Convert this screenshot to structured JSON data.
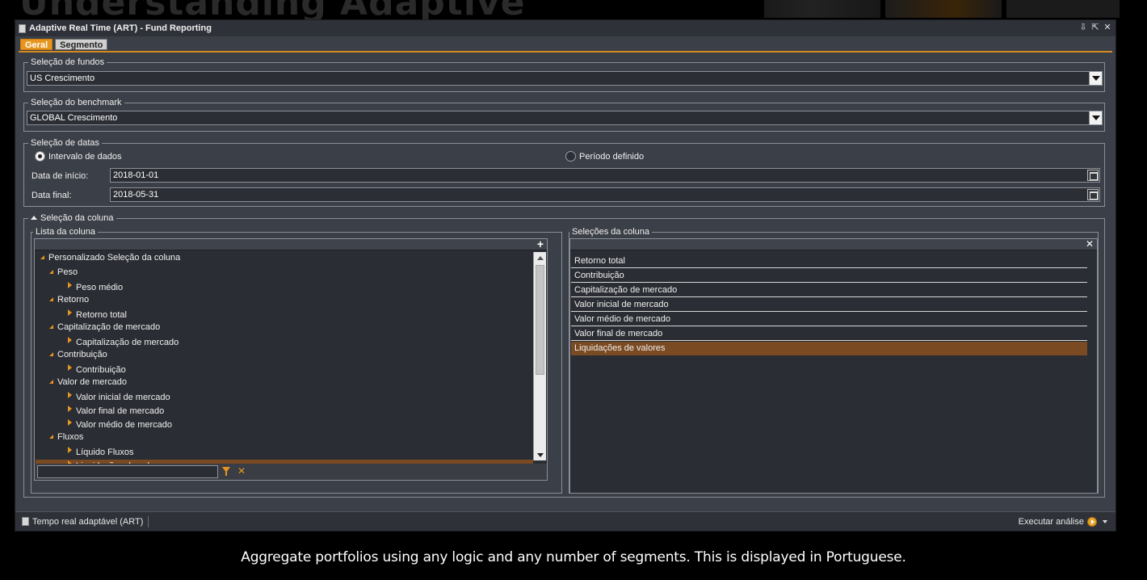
{
  "background": {
    "heading": "Understanding Adaptive"
  },
  "window": {
    "title": "Adaptive Real Time (ART) - Fund Reporting",
    "tabs": [
      {
        "label": "Geral",
        "active": true
      },
      {
        "label": "Segmento",
        "active": false
      }
    ]
  },
  "fund_selection": {
    "legend": "Seleção de fundos",
    "value": "US Crescimento"
  },
  "benchmark_selection": {
    "legend": "Seleção do benchmark",
    "value": "GLOBAL Crescimento"
  },
  "date_selection": {
    "legend": "Seleção de datas",
    "options": [
      {
        "label": "Intervalo de dados",
        "selected": true
      },
      {
        "label": "Período definido",
        "selected": false
      }
    ],
    "start_label": "Data de início:",
    "start_value": "2018-01-01",
    "end_label": "Data final:",
    "end_value": "2018-05-31"
  },
  "column_selection": {
    "legend": "Seleção da coluna",
    "list": {
      "legend": "Lista da coluna",
      "add_glyph": "+",
      "tree": [
        {
          "label": "Personalizado Seleção da coluna",
          "level": 0,
          "type": "expanded"
        },
        {
          "label": "Peso",
          "level": 1,
          "type": "expanded"
        },
        {
          "label": "Peso médio",
          "level": 2,
          "type": "leaf"
        },
        {
          "label": "Retorno",
          "level": 1,
          "type": "expanded"
        },
        {
          "label": "Retorno total",
          "level": 2,
          "type": "leaf"
        },
        {
          "label": "Capitalização de mercado",
          "level": 1,
          "type": "expanded"
        },
        {
          "label": "Capitalização de mercado",
          "level": 2,
          "type": "leaf"
        },
        {
          "label": "Contribuição",
          "level": 1,
          "type": "expanded"
        },
        {
          "label": "Contribuição",
          "level": 2,
          "type": "leaf"
        },
        {
          "label": "Valor de mercado",
          "level": 1,
          "type": "expanded"
        },
        {
          "label": "Valor inicial de mercado",
          "level": 2,
          "type": "leaf"
        },
        {
          "label": "Valor final de mercado",
          "level": 2,
          "type": "leaf"
        },
        {
          "label": "Valor médio de mercado",
          "level": 2,
          "type": "leaf"
        },
        {
          "label": "Fluxos",
          "level": 1,
          "type": "expanded"
        },
        {
          "label": "Líquido Fluxos",
          "level": 2,
          "type": "leaf"
        },
        {
          "label": "Liquidações de valores",
          "level": 2,
          "type": "leaf",
          "selected": true
        }
      ]
    },
    "selections": {
      "legend": "Seleções da coluna",
      "clear_glyph": "✕",
      "items": [
        {
          "label": "Retorno total"
        },
        {
          "label": "Contribuição"
        },
        {
          "label": "Capitalização de mercado"
        },
        {
          "label": "Valor inicial de mercado"
        },
        {
          "label": "Valor médio de mercado"
        },
        {
          "label": "Valor final de mercado"
        },
        {
          "label": "Liquidações de valores",
          "selected": true
        }
      ]
    }
  },
  "statusbar": {
    "left_label": "Tempo real adaptável (ART)",
    "run_label": "Executar análise"
  },
  "caption": "Aggregate portfolios using any logic and any number of segments. This is displayed in Portuguese.",
  "colors": {
    "accent": "#e6961e",
    "selection": "#7a4a22",
    "window_bg": "#3b3f47",
    "panel_bg": "#2a2d33"
  }
}
